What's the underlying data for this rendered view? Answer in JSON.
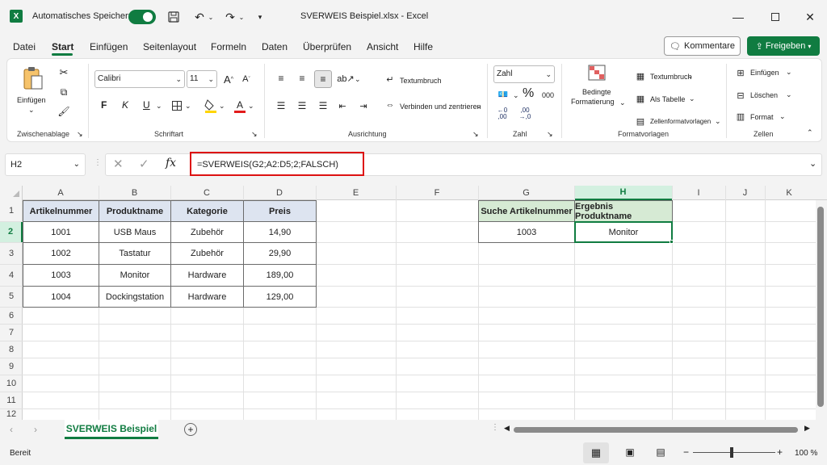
{
  "titlebar": {
    "autosave_label": "Automatisches Speichern",
    "file_title": "SVERWEIS Beispiel.xlsx",
    "separator": "-",
    "app_name": "Excel",
    "colors": {
      "accent": "#107c41"
    }
  },
  "menu": {
    "items": [
      "Datei",
      "Start",
      "Einfügen",
      "Seitenlayout",
      "Formeln",
      "Daten",
      "Überprüfen",
      "Ansicht",
      "Hilfe"
    ],
    "comment_button": "Kommentare",
    "share_button": "Freigeben"
  },
  "ribbon": {
    "clipboard": {
      "paste_label": "Einfügen",
      "group_label": "Zwischenablage"
    },
    "font": {
      "font_name": "Calibri",
      "font_size": "11",
      "bold": "F",
      "italic": "K",
      "underline": "U",
      "group_label": "Schriftart"
    },
    "alignment": {
      "wrap_text": "Textumbruch",
      "merge_center": "Verbinden und zentrieren",
      "group_label": "Ausrichtung"
    },
    "number": {
      "format": "Zahl",
      "percent": "%",
      "thousands": "000",
      "group_label": "Zahl"
    },
    "styles": {
      "conditional_line1": "Bedingte",
      "conditional_line2": "Formatierung",
      "textumbruch": "Textumbruch",
      "as_table": "Als Tabelle",
      "cell_styles": "Zellenformatvorlagen",
      "group_label": "Formatvorlagen"
    },
    "cells": {
      "insert": "Einfügen",
      "delete": "Löschen",
      "format": "Format",
      "group_label": "Zellen"
    }
  },
  "formula_bar": {
    "name_box": "H2",
    "fx": "fx",
    "formula": "=SVERWEIS(G2;A2:D5;2;FALSCH)"
  },
  "grid": {
    "columns": [
      "A",
      "B",
      "C",
      "D",
      "E",
      "F",
      "G",
      "H",
      "I",
      "J",
      "K"
    ],
    "rows": [
      "1",
      "2",
      "3",
      "4",
      "5",
      "6",
      "7",
      "8",
      "9",
      "10",
      "11",
      "12"
    ],
    "table_headers": [
      "Artikelnummer",
      "Produktname",
      "Kategorie",
      "Preis"
    ],
    "table_rows": [
      [
        "1001",
        "USB Maus",
        "Zubehör",
        "14,90"
      ],
      [
        "1002",
        "Tastatur",
        "Zubehör",
        "29,90"
      ],
      [
        "1003",
        "Monitor",
        "Hardware",
        "189,00"
      ],
      [
        "1004",
        "Dockingstation",
        "Hardware",
        "129,00"
      ]
    ],
    "lookup_header_g": "Suche Artikelnummer",
    "lookup_header_h": "Ergebnis Produktname",
    "lookup_value": "1003",
    "lookup_result": "Monitor"
  },
  "sheetbar": {
    "active_sheet": "SVERWEIS Beispiel"
  },
  "statusbar": {
    "status": "Bereit",
    "zoom": "100 %"
  }
}
